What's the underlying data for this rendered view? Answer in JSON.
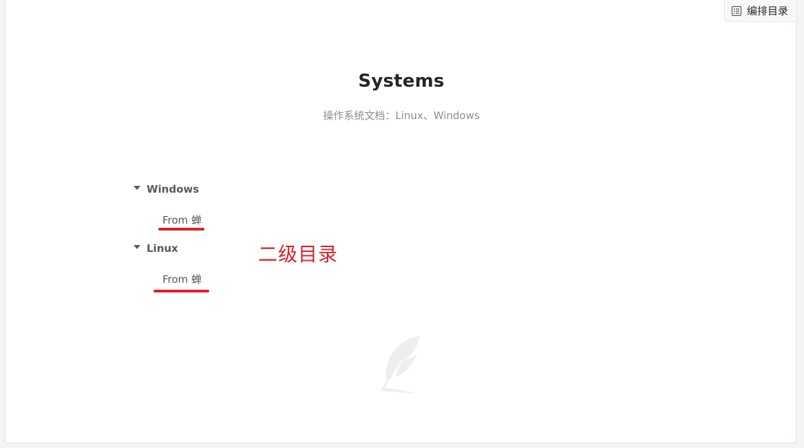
{
  "toolbar": {
    "toc_button_label": "编排目录",
    "toc_icon": "list-icon"
  },
  "header": {
    "title": "Systems",
    "subtitle": "操作系统文档：Linux、Windows"
  },
  "catalog": {
    "groups": [
      {
        "label": "Windows",
        "expanded": true,
        "items": [
          {
            "label": "From 蝉"
          }
        ]
      },
      {
        "label": "Linux",
        "expanded": true,
        "items": [
          {
            "label": "From 蝉"
          }
        ]
      }
    ]
  },
  "annotation": {
    "text": "二级目录",
    "color": "#e0202a"
  },
  "decoration": {
    "icon": "feather-icon"
  }
}
